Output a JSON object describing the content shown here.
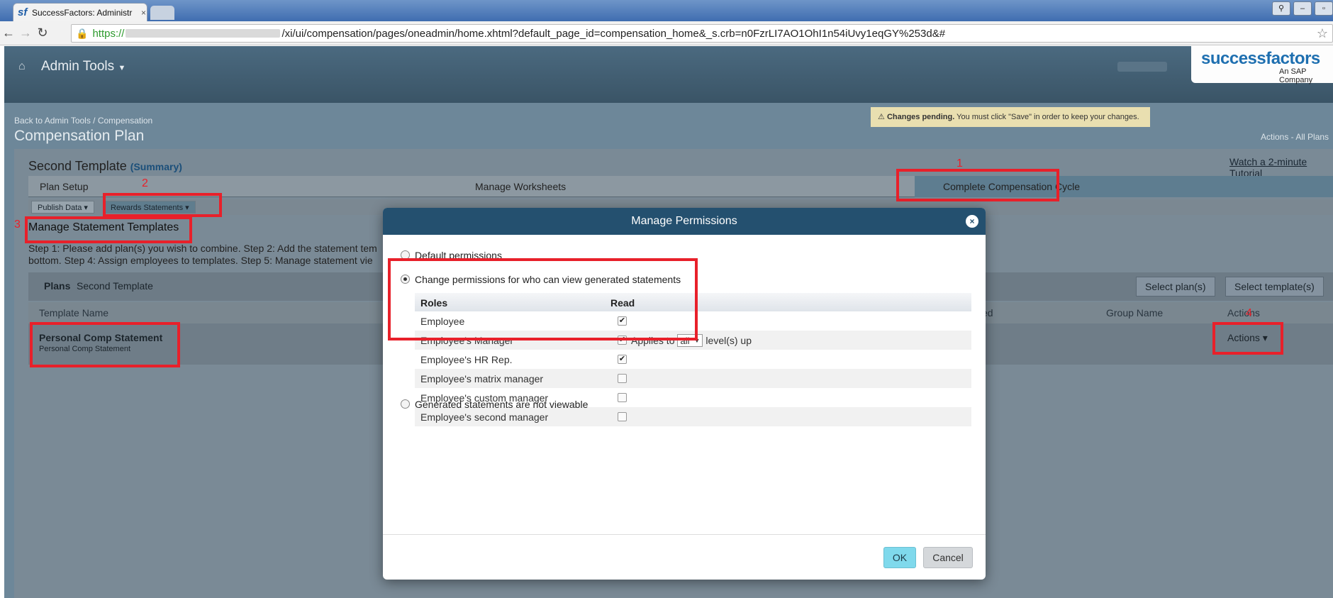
{
  "browser": {
    "tab_title": "SuccessFactors: Administr",
    "tab_close": "×",
    "url_scheme": "https://",
    "url_path": "/xi/ui/compensation/pages/oneadmin/home.xhtml?default_page_id=compensation_home&_s.crb=n0FzrLI7AO1OhI1n54iUvy1eqGY%253d&#"
  },
  "header": {
    "menu_label": "Admin Tools",
    "logo_text": "successfactors",
    "logo_sub": "An SAP Company"
  },
  "page": {
    "breadcrumb": "Back to Admin Tools / Compensation",
    "title": "Compensation Plan",
    "pending_bold": "Changes pending.",
    "pending_text": "You must click \"Save\" in order to keep your changes.",
    "actions_all": "Actions - All Plans"
  },
  "template": {
    "name": "Second Template",
    "summary": "Summary",
    "tutorial": "Watch a 2-minute Tutorial",
    "steps": [
      "Plan Setup",
      "Manage Worksheets",
      "Complete Compensation Cycle"
    ],
    "subtabs": [
      "Publish Data",
      "Rewards Statements"
    ]
  },
  "manager": {
    "title": "Manage Statement Templates",
    "steps_line1": "Step 1: Please add plan(s) you wish to combine. Step 2: Add the statement tem",
    "steps_line2": "bottom. Step 4: Assign employees to templates. Step 5: Manage statement vie",
    "plans_label": "Plans",
    "plans_value": "Second Template",
    "select_plans": "Select plan(s)",
    "select_template": "Select template(s)",
    "columns": [
      "Template Name",
      "ed",
      "Group Name",
      "Actions"
    ],
    "row_name": "Personal Comp Statement",
    "row_sub": "Personal Comp Statement",
    "row_actions": "Actions"
  },
  "annotations": [
    "1",
    "2",
    "3",
    "4"
  ],
  "modal": {
    "title": "Manage Permissions",
    "close": "×",
    "opt_default": "Default permissions",
    "opt_change": "Change permissions for who can view generated statements",
    "opt_none": "Generated statements are not viewable",
    "col_roles": "Roles",
    "col_read": "Read",
    "applies_to": "Applies to",
    "applies_value": "all",
    "applies_suffix": "level(s) up",
    "roles": [
      {
        "name": "Employee",
        "checked": "✔"
      },
      {
        "name": "Employee's Manager",
        "checked": "✔"
      },
      {
        "name": "Employee's HR Rep.",
        "checked": "✔"
      },
      {
        "name": "Employee's matrix manager",
        "checked": ""
      },
      {
        "name": "Employee's custom manager",
        "checked": ""
      },
      {
        "name": "Employee's second manager",
        "checked": ""
      }
    ],
    "ok": "OK",
    "cancel": "Cancel"
  }
}
